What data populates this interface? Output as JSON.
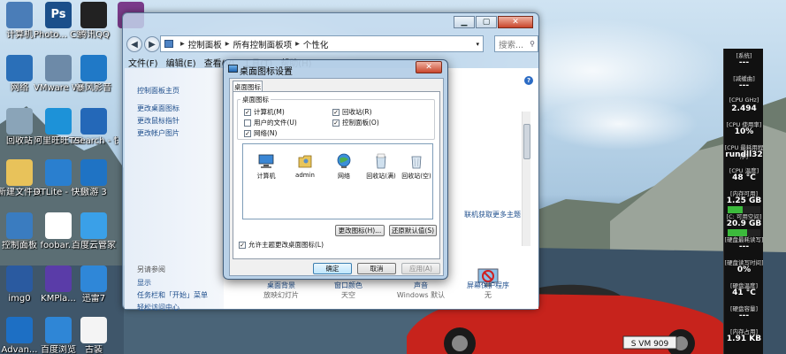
{
  "desktop_icons": [
    {
      "label": "计算机",
      "icon": "computer-icon",
      "color": "#4a7db8"
    },
    {
      "label": "Photo... CS3",
      "icon": "photoshop-icon",
      "color": "#1b4f8a",
      "glyph": "Ps"
    },
    {
      "label": "腾讯QQ",
      "icon": "qq-penguin-icon",
      "color": "#222222"
    },
    {
      "label": "",
      "icon": "winrar-icon",
      "color": "#7a3b8a"
    },
    {
      "label": "网络",
      "icon": "network-globe-icon",
      "color": "#2a6fb8"
    },
    {
      "label": "VMware Workst...",
      "icon": "vmware-icon",
      "color": "#6d8aa8"
    },
    {
      "label": "暴风影音",
      "icon": "media-player-icon",
      "color": "#2079c7"
    },
    {
      "label": "回收站",
      "icon": "recycle-bin-icon",
      "color": "#8aa4b8"
    },
    {
      "label": "阿里旺旺 2014",
      "icon": "aliwangwang-icon",
      "color": "#1d92d8"
    },
    {
      "label": "TSearch - 快捷...",
      "icon": "search-tool-icon",
      "color": "#2468b8"
    },
    {
      "label": "新建文件夹",
      "icon": "folder-icon",
      "color": "#e8c25a"
    },
    {
      "label": "DTLite - 快捷方式",
      "icon": "daemon-tools-icon",
      "color": "#2a7fcf"
    },
    {
      "label": "傲游 3",
      "icon": "maxthon-icon",
      "color": "#1f73c4"
    },
    {
      "label": "控制面板",
      "icon": "control-panel-icon",
      "color": "#3a7cc0"
    },
    {
      "label": "foobar...",
      "icon": "foobar-icon",
      "color": "#ffffff"
    },
    {
      "label": "百度云管家",
      "icon": "baidu-cloud-icon",
      "color": "#3aa0e8"
    },
    {
      "label": "img0",
      "icon": "image-file-icon",
      "color": "#2a5aa0"
    },
    {
      "label": "KMPla...",
      "icon": "kmplayer-icon",
      "color": "#5a3ca8"
    },
    {
      "label": "迅雷7",
      "icon": "xunlei-icon",
      "color": "#2f87d8"
    },
    {
      "label": "Advan...",
      "icon": "advanced-icon",
      "color": "#1d6fc4"
    },
    {
      "label": "百度浏览",
      "icon": "baidu-browser-icon",
      "color": "#2f86d6"
    },
    {
      "label": "古装",
      "icon": "document-icon",
      "color": "#f4f4f4"
    }
  ],
  "control_panel": {
    "breadcrumb": [
      "控制面板",
      "所有控制面板项",
      "个性化"
    ],
    "search_placeholder": "搜索...",
    "menu": [
      "文件(F)",
      "编辑(E)",
      "查看(V)",
      "工具(T)",
      "帮助(H)"
    ],
    "side_links": [
      "控制面板主页",
      "更改桌面图标",
      "更改鼠标指针",
      "更改帐户图片"
    ],
    "see_also_header": "另请参阅",
    "see_also_links": [
      "显示",
      "任务栏和「开始」菜单",
      "轻松访问中心"
    ],
    "assoc_link": "联机获取更多主题",
    "bottom_items": [
      {
        "title": "桌面背景",
        "sub": "放映幻灯片"
      },
      {
        "title": "窗口颜色",
        "sub": "天空"
      },
      {
        "title": "声音",
        "sub": "Windows 默认"
      },
      {
        "title": "屏幕保护程序",
        "sub": "无"
      }
    ]
  },
  "dialog": {
    "title": "桌面图标设置",
    "tab": "桌面图标",
    "group_label": "桌面图标",
    "checkboxes": [
      {
        "label": "计算机(M)",
        "checked": true
      },
      {
        "label": "回收站(R)",
        "checked": true
      },
      {
        "label": "用户的文件(U)",
        "checked": false
      },
      {
        "label": "控制面板(O)",
        "checked": true
      },
      {
        "label": "网络(N)",
        "checked": true
      }
    ],
    "icons": [
      {
        "label": "计算机",
        "icon": "computer-icon"
      },
      {
        "label": "admin",
        "icon": "user-folder-icon"
      },
      {
        "label": "网络",
        "icon": "network-globe-icon"
      },
      {
        "label": "回收站(满)",
        "icon": "recycle-bin-full-icon"
      },
      {
        "label": "回收站(空)",
        "icon": "recycle-bin-empty-icon"
      }
    ],
    "change_icon": "更改图标(H)...",
    "restore_default": "还原默认值(S)",
    "allow_themes": "允许主题更改桌面图标(L)",
    "allow_themes_checked": true,
    "ok": "确定",
    "cancel": "取消",
    "apply": "应用(A)"
  },
  "gadget": {
    "rows": [
      {
        "label": "[系统]",
        "value": "---"
      },
      {
        "label": "[减缓曲]",
        "value": "---"
      },
      {
        "label": "[CPU GHz]",
        "value": "2.494"
      },
      {
        "label": "[CPU 使用率]",
        "value": "10%"
      },
      {
        "label": "[CPU 最耗用程序]",
        "value": "rundll32"
      },
      {
        "label": "[CPU 温度]",
        "value": "48 °C"
      },
      {
        "label": "[内存可用]",
        "value": "1.25 GB"
      },
      {
        "label": "[C: 可用空间]",
        "value": "20.9 GB"
      },
      {
        "label": "[硬盘最耗读写]",
        "value": "---"
      },
      {
        "label": "[硬盘读写时间]",
        "value": "0%"
      },
      {
        "label": "[硬盘温度]",
        "value": "41 °C"
      },
      {
        "label": "[硬盘容量]",
        "value": "---"
      },
      {
        "label": "[内存占用]",
        "value": "1.91 KB"
      }
    ],
    "memory_fill": 0.45,
    "disk_fill": 0.6
  },
  "license_plate": "S VM 909"
}
